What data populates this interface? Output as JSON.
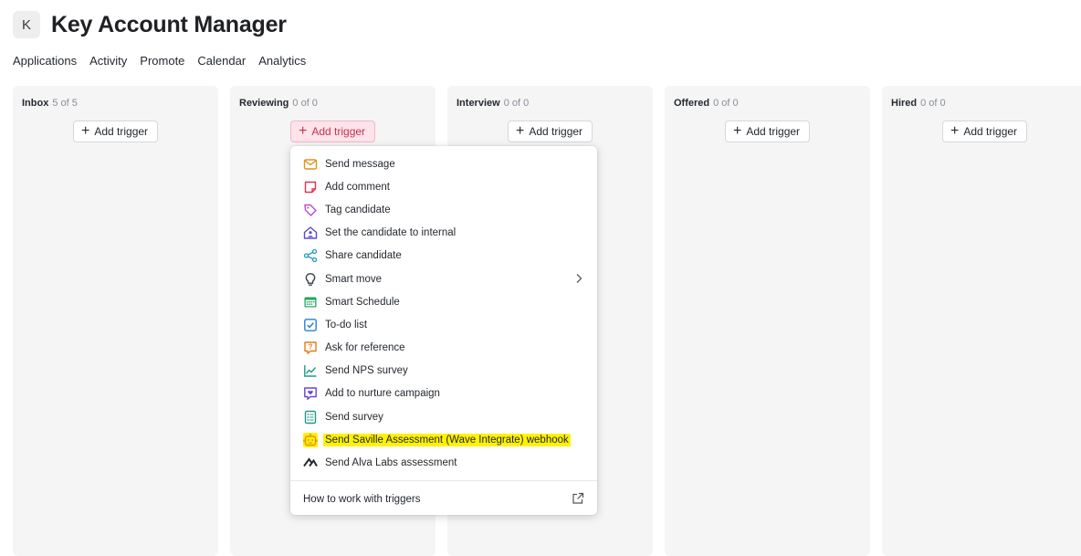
{
  "header": {
    "avatar_letter": "K",
    "title": "Key Account Manager"
  },
  "nav": [
    "Applications",
    "Activity",
    "Promote",
    "Calendar",
    "Analytics"
  ],
  "columns": [
    {
      "name": "Inbox",
      "count": "5 of 5",
      "button": "Add trigger"
    },
    {
      "name": "Reviewing",
      "count": "0 of 0",
      "button": "Add trigger"
    },
    {
      "name": "Interview",
      "count": "0 of 0",
      "button": "Add trigger"
    },
    {
      "name": "Offered",
      "count": "0 of 0",
      "button": "Add trigger"
    },
    {
      "name": "Hired",
      "count": "0 of 0",
      "button": "Add trigger"
    }
  ],
  "menu": {
    "items": [
      {
        "label": "Send message",
        "icon": "envelope-icon"
      },
      {
        "label": "Add comment",
        "icon": "sticky-note-icon"
      },
      {
        "label": "Tag candidate",
        "icon": "tag-icon"
      },
      {
        "label": "Set the candidate to internal",
        "icon": "house-person-icon"
      },
      {
        "label": "Share candidate",
        "icon": "share-icon"
      },
      {
        "label": "Smart move",
        "icon": "lightbulb-icon"
      },
      {
        "label": "Smart Schedule",
        "icon": "calendar-grid-icon"
      },
      {
        "label": "To-do list",
        "icon": "checkbox-icon"
      },
      {
        "label": "Ask for reference",
        "icon": "question-bubble-icon"
      },
      {
        "label": "Send NPS survey",
        "icon": "line-chart-icon"
      },
      {
        "label": "Add to nurture campaign",
        "icon": "heart-bubble-icon"
      },
      {
        "label": "Send survey",
        "icon": "clipboard-list-icon"
      },
      {
        "label": "Send Saville Assessment (Wave Integrate) webhook",
        "icon": "robot-icon"
      },
      {
        "label": "Send Alva Labs assessment",
        "icon": "alva-logo-icon"
      }
    ],
    "footer": "How to work with triggers"
  },
  "colors": {
    "accent_pink": "#c2324f",
    "highlight": "#fff200",
    "column_bg": "#f5f5f6"
  }
}
